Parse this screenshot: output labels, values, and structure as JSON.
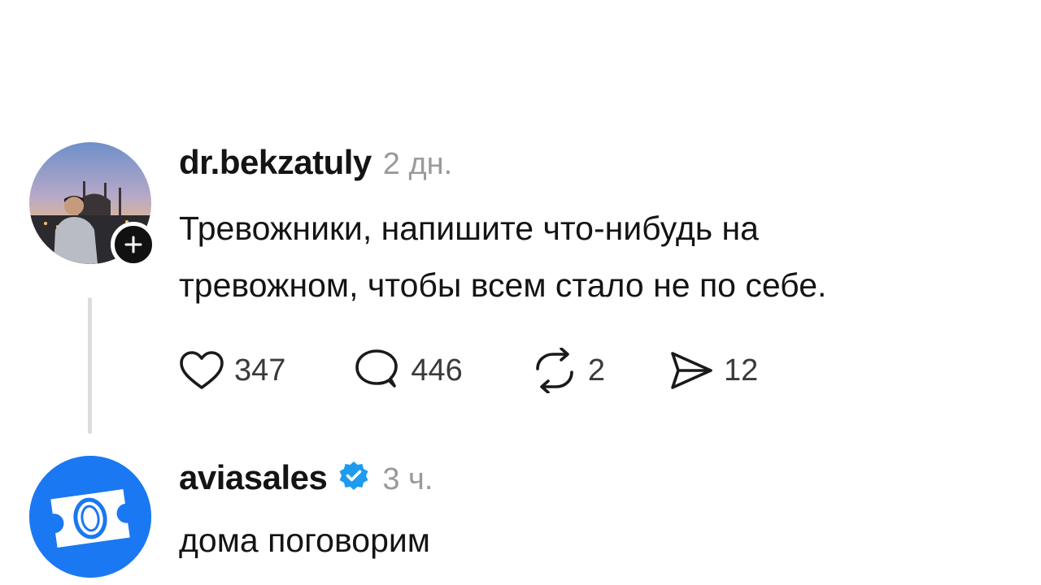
{
  "comments": [
    {
      "username": "dr.bekzatuly",
      "time": "2 дн.",
      "text_line1": "Тревожники, напишите что-нибудь на",
      "text_line2": "тревожном, чтобы всем стало не по себе.",
      "likes": "347",
      "replies": "446",
      "reposts": "2",
      "shares": "12"
    },
    {
      "username": "aviasales",
      "verified": true,
      "time": "3 ч.",
      "text": "дома поговорим"
    }
  ],
  "icons": {
    "like": "heart-icon",
    "reply": "speech-bubble-icon",
    "repost": "repost-icon",
    "share": "paper-plane-icon",
    "follow": "plus-icon",
    "verified": "verified-badge-icon"
  },
  "colors": {
    "verified": "#1d9bf0",
    "aviasales_brand": "#1a78f2",
    "meta_text": "#9a9a9a"
  }
}
